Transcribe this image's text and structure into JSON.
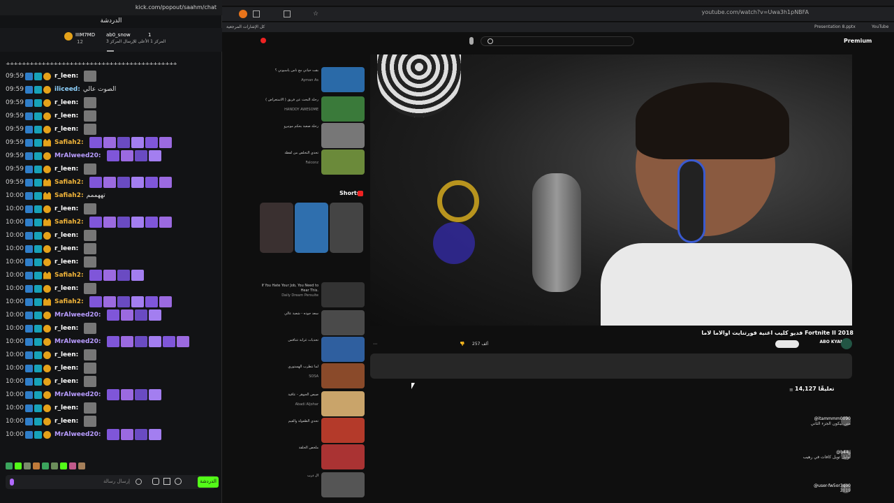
{
  "chat": {
    "url": "kick.com/popout/saahm/chat",
    "title": "الدردشة",
    "pinned": {
      "user": "IIIM7MD",
      "user2": "ab0_snow",
      "count1": "1",
      "count2": "12",
      "text": "المركز 1 الأعلى للإرسال المركز 3"
    },
    "messages": [
      {
        "time": "09:59",
        "user": "r_leen:",
        "color": "#ffffff",
        "text": ""
      },
      {
        "time": "09:59",
        "user": "iliceed:",
        "color": "#8fd3ff",
        "text": "الصوت عالي"
      },
      {
        "time": "09:59",
        "user": "r_leen:",
        "color": "#ffffff",
        "text": ""
      },
      {
        "time": "09:59",
        "user": "r_leen:",
        "color": "#ffffff",
        "text": ""
      },
      {
        "time": "09:59",
        "user": "r_leen:",
        "color": "#ffffff",
        "text": ""
      },
      {
        "time": "09:59",
        "user": "Safiah2:",
        "color": "#f2b53a",
        "text": ""
      },
      {
        "time": "09:59",
        "user": "MrAlweed20:",
        "color": "#b89cff",
        "text": ""
      },
      {
        "time": "09:59",
        "user": "r_leen:",
        "color": "#ffffff",
        "text": ""
      },
      {
        "time": "09:59",
        "user": "Safiah2:",
        "color": "#f2b53a",
        "text": ""
      },
      {
        "time": "10:00",
        "user": "Safiah2:",
        "color": "#f2b53a",
        "text": "تههممم"
      },
      {
        "time": "10:00",
        "user": "r_leen:",
        "color": "#ffffff",
        "text": ""
      },
      {
        "time": "10:00",
        "user": "Safiah2:",
        "color": "#f2b53a",
        "text": ""
      },
      {
        "time": "10:00",
        "user": "r_leen:",
        "color": "#ffffff",
        "text": ""
      },
      {
        "time": "10:00",
        "user": "r_leen:",
        "color": "#ffffff",
        "text": ""
      },
      {
        "time": "10:00",
        "user": "r_leen:",
        "color": "#ffffff",
        "text": ""
      },
      {
        "time": "10:00",
        "user": "Safiah2:",
        "color": "#f2b53a",
        "text": ""
      },
      {
        "time": "10:00",
        "user": "r_leen:",
        "color": "#ffffff",
        "text": ""
      },
      {
        "time": "10:00",
        "user": "Safiah2:",
        "color": "#f2b53a",
        "text": ""
      },
      {
        "time": "10:00",
        "user": "MrAlweed20:",
        "color": "#b89cff",
        "text": ""
      },
      {
        "time": "10:00",
        "user": "r_leen:",
        "color": "#ffffff",
        "text": ""
      },
      {
        "time": "10:00",
        "user": "MrAlweed20:",
        "color": "#b89cff",
        "text": ""
      },
      {
        "time": "10:00",
        "user": "r_leen:",
        "color": "#ffffff",
        "text": ""
      },
      {
        "time": "10:00",
        "user": "r_leen:",
        "color": "#ffffff",
        "text": ""
      },
      {
        "time": "10:00",
        "user": "r_leen:",
        "color": "#ffffff",
        "text": ""
      },
      {
        "time": "10:00",
        "user": "MrAlweed20:",
        "color": "#b89cff",
        "text": ""
      },
      {
        "time": "10:00",
        "user": "r_leen:",
        "color": "#ffffff",
        "text": ""
      },
      {
        "time": "10:00",
        "user": "r_leen:",
        "color": "#ffffff",
        "text": ""
      },
      {
        "time": "10:00",
        "user": "MrAlweed20:",
        "color": "#b89cff",
        "text": ""
      }
    ],
    "input_placeholder": "إرسال رسالة",
    "send_label": "الدردشة"
  },
  "browser": {
    "url": "youtube.com/watch?v=Uwa3h1pNBFA",
    "bookmarks": [
      "كل الإشارات المرجعية",
      "Presentation 8.pptx",
      "YouTube"
    ],
    "premium": "Premium",
    "video_title": "فديو كليب اغنية فورتنايت اوالاما لاما Fortnite II 2018",
    "channel": "ABO KYAN",
    "likes": "257 ألف",
    "comments_count": "14,127 تعليقًا",
    "shorts_label": "Shorts",
    "recs": [
      {
        "title": "بقت حياتي مع ناس ياسبوني ؟",
        "meta": "Ayman As"
      },
      {
        "title": "رحلة البحث عن فريق ( الاستعراض )",
        "meta": "HANDDY AWESOME"
      },
      {
        "title": "رحلة صعبة بحكم مونيرو",
        "meta": ""
      },
      {
        "title": "تحدي التخلص من لقطة",
        "meta": "Falconz"
      },
      {
        "title": "If You Hate Your Job, You Need to Hear This.",
        "meta": "Daily Dream Persuite"
      },
      {
        "title": "سعد جوده - شعبة عالي",
        "meta": ""
      },
      {
        "title": "تحديات غرابة تتنافس",
        "meta": ""
      },
      {
        "title": "لما تتطرب الهستوري",
        "meta": "SOSA"
      },
      {
        "title": "صيص الجوهر - عافية",
        "meta": "Abadi Aljohar"
      },
      {
        "title": "تحدي الطفولة والقيم",
        "meta": ""
      },
      {
        "title": "ملخص الحلقة",
        "meta": ""
      },
      {
        "title": "ال درب",
        "meta": ""
      }
    ],
    "comments": [
      {
        "user": "@itammmm0090",
        "text": "متى بيكون الجزء الثاني"
      },
      {
        "user": "@b44jj",
        "text": "لوليل تويل كافات في رهيب"
      },
      {
        "user": "@user-fw5or3qo0",
        "text": "2019"
      }
    ]
  }
}
